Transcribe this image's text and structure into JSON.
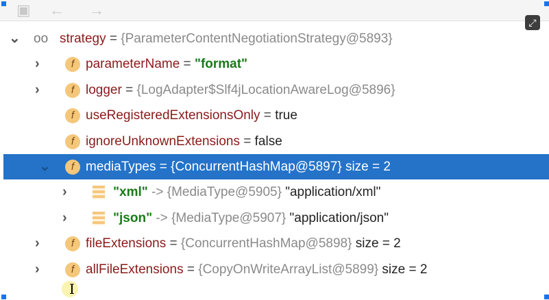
{
  "toolbar": {
    "icons": [
      "restore-layout-icon",
      "back-arrow-icon",
      "forward-arrow-icon"
    ],
    "expand_icon": "expand-icon"
  },
  "accent": "#2473c9",
  "rows": [
    {
      "name": "strategy",
      "eq": " = ",
      "value": "{ParameterContentNegotiationStrategy@5893}",
      "expanded": true
    },
    {
      "name": "parameterName",
      "eq": " = ",
      "value": "\"format\""
    },
    {
      "name": "logger",
      "eq": " = ",
      "value": "{LogAdapter$Slf4jLocationAwareLog@5896}"
    },
    {
      "name": "useRegisteredExtensionsOnly",
      "eq": " = ",
      "value": "true"
    },
    {
      "name": "ignoreUnknownExtensions",
      "eq": " = ",
      "value": "false"
    },
    {
      "name": "mediaTypes",
      "eq": " = ",
      "value": "{ConcurrentHashMap@5897}",
      "size": "  size = 2",
      "selected": true
    },
    {
      "key": "\"xml\"",
      "arrow": " -> ",
      "value": "{MediaType@5905}",
      "str": " \"application/xml\""
    },
    {
      "key": "\"json\"",
      "arrow": " -> ",
      "value": "{MediaType@5907}",
      "str": " \"application/json\""
    },
    {
      "name": "fileExtensions",
      "eq": " = ",
      "value": "{ConcurrentHashMap@5898}",
      "size": "  size = 2"
    },
    {
      "name": "allFileExtensions",
      "eq": " = ",
      "value": "{CopyOnWriteArrayList@5899}",
      "size": "  size = 2"
    }
  ]
}
